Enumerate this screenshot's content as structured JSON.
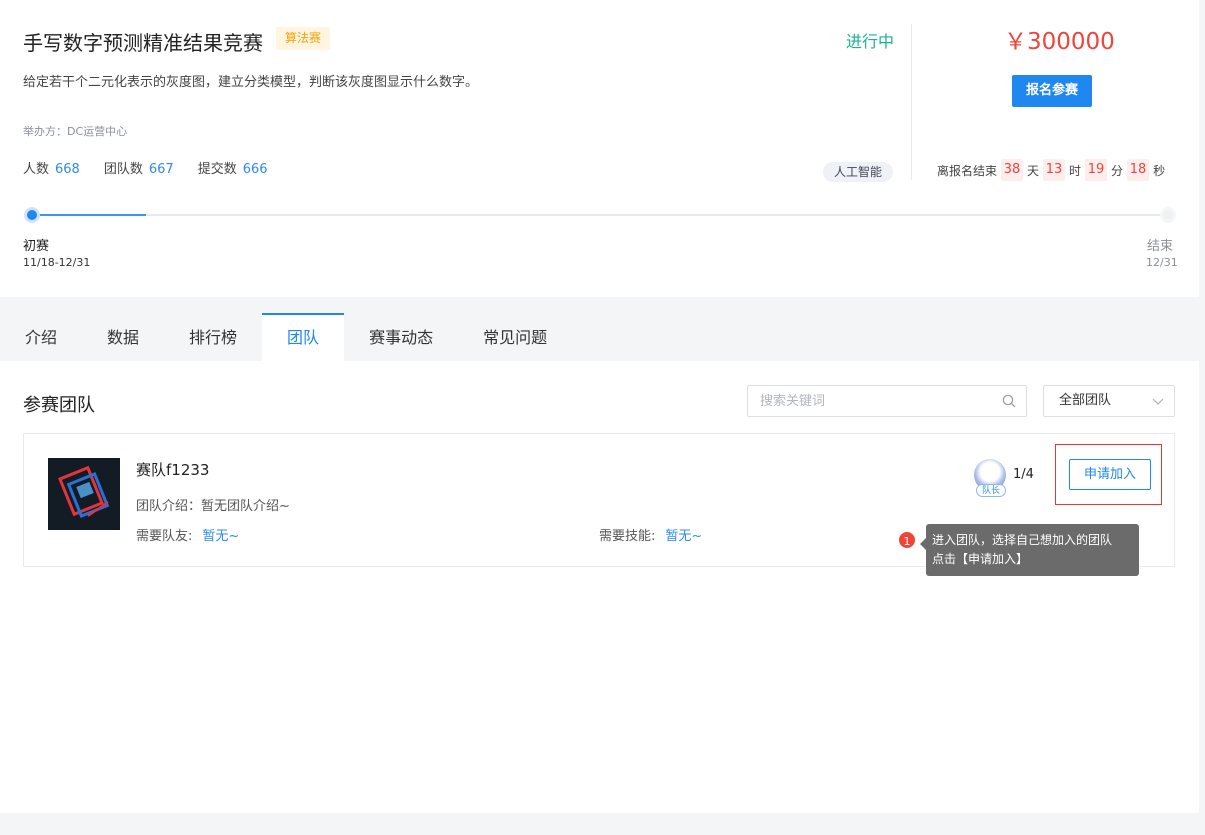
{
  "competition": {
    "title": "手写数字预测精准结果竞赛",
    "type_tag": "算法赛",
    "status": "进行中",
    "description": "给定若干个二元化表示的灰度图，建立分类模型，判断该灰度图显示什么数字。",
    "organizer": "举办方：DC运营中心",
    "stats": [
      {
        "label": "人数",
        "value": "668"
      },
      {
        "label": "团队数",
        "value": "667"
      },
      {
        "label": "提交数",
        "value": "666"
      }
    ],
    "category_tag": "人工智能",
    "prize": "￥300000",
    "signup_label": "报名参赛",
    "countdown": {
      "prefix": "离报名结束",
      "days": "38",
      "days_unit": "天",
      "hours": "13",
      "hours_unit": "时",
      "minutes": "19",
      "minutes_unit": "分",
      "seconds": "18",
      "seconds_unit": "秒"
    },
    "timeline": {
      "progress": 0.1,
      "start": {
        "name": "初赛",
        "date": "11/18-12/31"
      },
      "end": {
        "name": "结束",
        "date": "12/31"
      }
    }
  },
  "tabs": [
    {
      "label": "介绍",
      "active": false
    },
    {
      "label": "数据",
      "active": false
    },
    {
      "label": "排行榜",
      "active": false
    },
    {
      "label": "团队",
      "active": true
    },
    {
      "label": "赛事动态",
      "active": false
    },
    {
      "label": "常见问题",
      "active": false
    }
  ],
  "teams_section": {
    "title": "参赛团队",
    "search_placeholder": "搜索关键词",
    "filter_selected": "全部团队"
  },
  "team_card": {
    "name": "赛队f1233",
    "intro": "团队介绍：暂无团队介绍~",
    "need_members_label": "需要队友:",
    "need_members_value": "暂无~",
    "need_skills_label": "需要技能:",
    "need_skills_value": "暂无~",
    "leader_badge": "队长",
    "member_count": "1/4",
    "join_label": "申请加入"
  },
  "guide_tip": {
    "step": "1",
    "line1": "进入团队，选择自己想加入的团队",
    "line2": "点击【申请加入】"
  },
  "colors": {
    "primary": "#1e87f0",
    "danger": "#f0443a",
    "success": "#1ab394",
    "warning": "#f2a30a"
  }
}
